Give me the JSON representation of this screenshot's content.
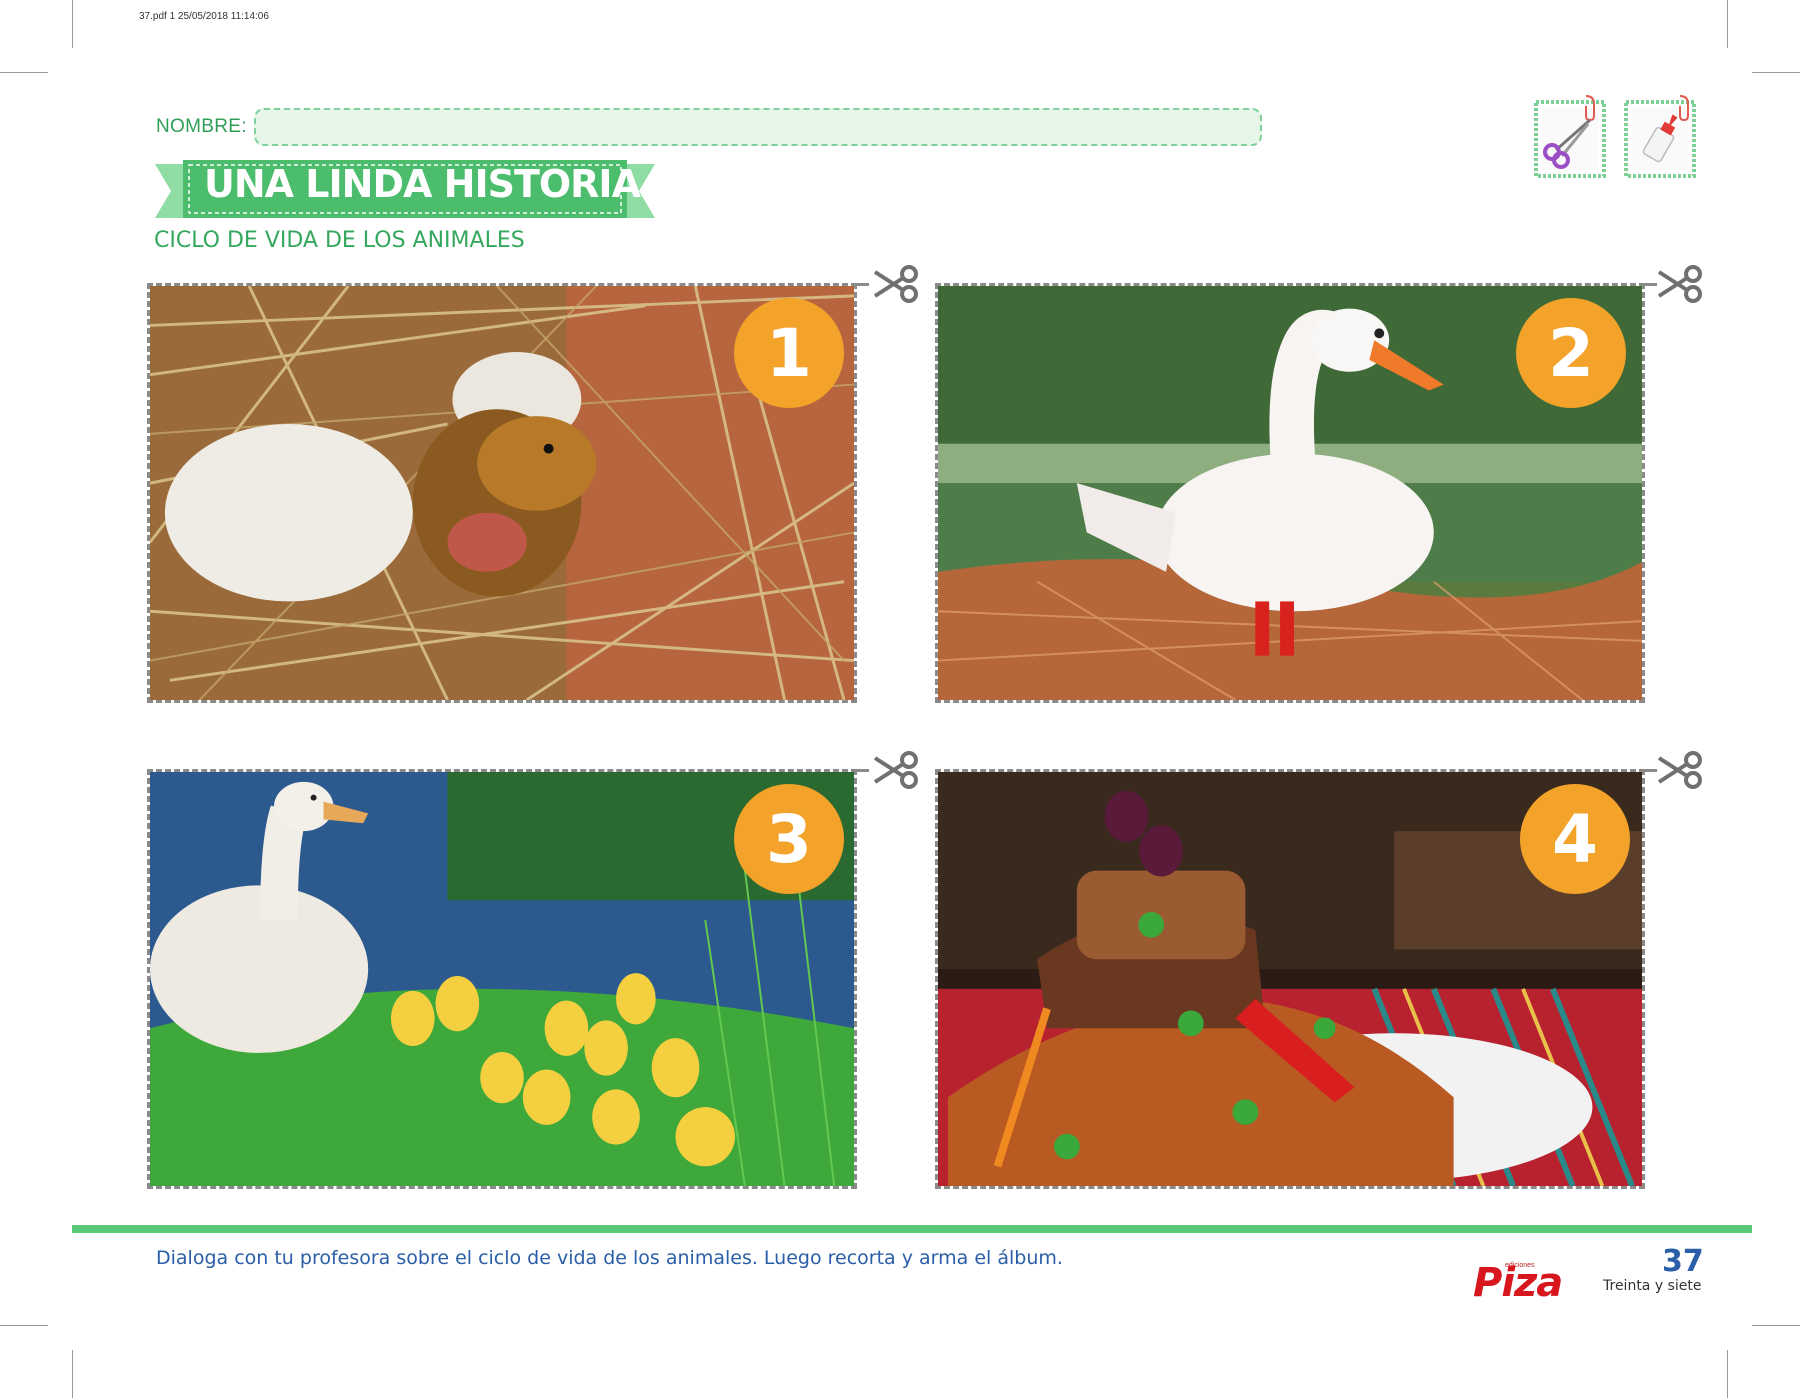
{
  "pdf_info": "37.pdf  1  25/05/2018  11:14:06",
  "form": {
    "name_label": "NOMBRE:"
  },
  "title": "UNA LINDA HISTORIA",
  "subtitle": "CICLO DE VIDA DE LOS ANIMALES",
  "tools": [
    "scissors-icon",
    "glue-bottle-icon"
  ],
  "cards": [
    {
      "number": "1",
      "scene": "duckling-hatching-from-egg"
    },
    {
      "number": "2",
      "scene": "white-duck-by-water"
    },
    {
      "number": "3",
      "scene": "duck-with-ducklings"
    },
    {
      "number": "4",
      "scene": "duck-rice-dish"
    }
  ],
  "footer": {
    "instructions": "Dialoga con tu profesora sobre el ciclo de vida de los animales. Luego recorta y arma el álbum.",
    "publisher_small": "ediciones",
    "publisher": "Piza",
    "page_number": "37",
    "page_words": "Treinta y siete"
  },
  "colors": {
    "green": "#59c878",
    "orange_badge": "#f3a22a",
    "blue_text": "#2a5ea8",
    "logo_red": "#d7161e"
  }
}
